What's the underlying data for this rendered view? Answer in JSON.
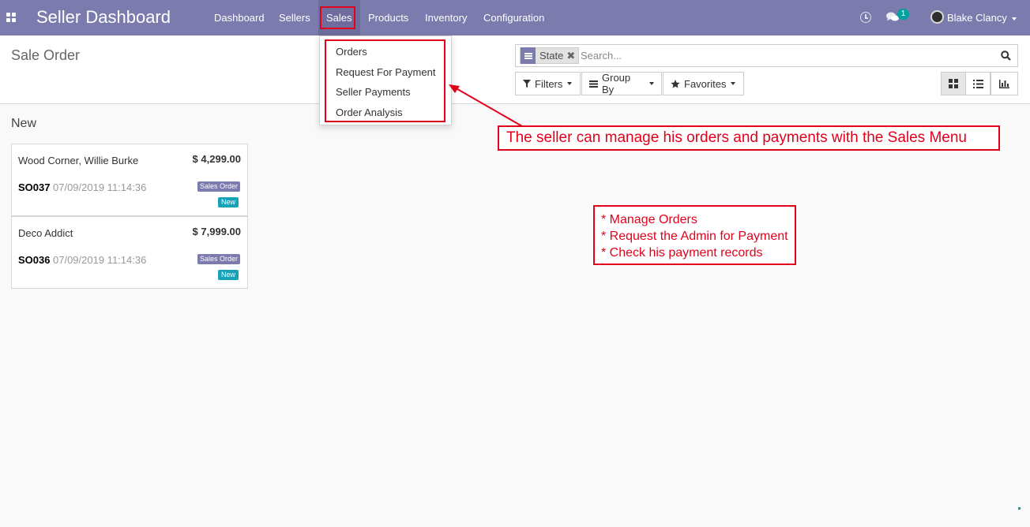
{
  "navbar": {
    "brand": "Seller Dashboard",
    "menu": [
      "Dashboard",
      "Sellers",
      "Sales",
      "Products",
      "Inventory",
      "Configuration"
    ],
    "active_menu": "Sales",
    "message_count": "1",
    "user_name": "Blake Clancy",
    "color": "#7c7bad"
  },
  "breadcrumb": "Sale Order",
  "sales_dropdown": {
    "items": [
      "Orders",
      "Request For Payment",
      "Seller Payments",
      "Order Analysis"
    ]
  },
  "search": {
    "facet_label": "State",
    "placeholder": "Search..."
  },
  "filters": {
    "filters_label": "Filters",
    "group_by_label": "Group By",
    "favorites_label": "Favorites"
  },
  "views": [
    "kanban-icon",
    "list-icon",
    "graph-icon"
  ],
  "active_view": "kanban",
  "kanban": {
    "column_title": "New",
    "cards": [
      {
        "partner": "Wood Corner, Willie Burke",
        "amount": "$ 4,299.00",
        "ref": "SO037",
        "date": "07/09/2019 11:14:36",
        "tag": "Sales Order",
        "state": "New"
      },
      {
        "partner": "Deco Addict",
        "amount": "$ 7,999.00",
        "ref": "SO036",
        "date": "07/09/2019 11:14:36",
        "tag": "Sales Order",
        "state": "New"
      }
    ]
  },
  "annotations": {
    "main": "The seller can manage his orders and payments with the Sales Menu",
    "list": [
      "* Manage Orders",
      "* Request the Admin for Payment",
      "* Check his payment records"
    ],
    "color": "#e3001b"
  }
}
